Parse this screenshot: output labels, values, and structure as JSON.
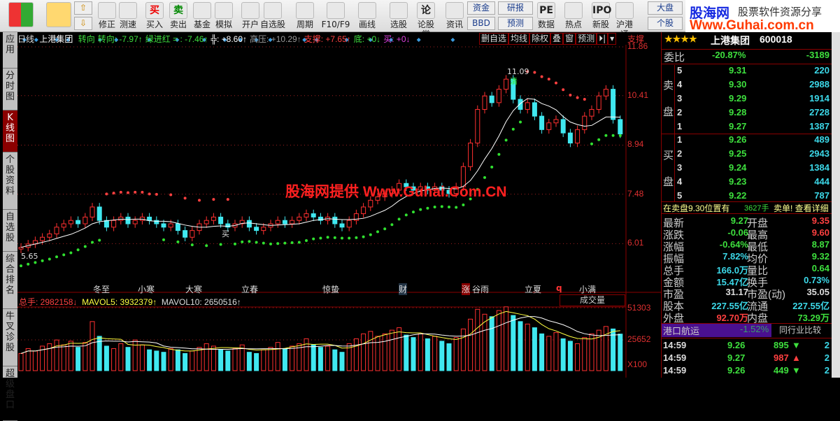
{
  "toolbar": {
    "buttons": [
      {
        "label": "",
        "icon": "windows-grid-icon"
      },
      {
        "label": "",
        "icon": "back-arrow-icon"
      },
      {
        "label": "修正",
        "icon": "refresh-icon"
      },
      {
        "label": "测速",
        "icon": "clock-icon"
      },
      {
        "label": "买入",
        "icon": "buy-icon",
        "glyph": "买"
      },
      {
        "label": "卖出",
        "icon": "sell-icon",
        "glyph": "卖"
      },
      {
        "label": "基金",
        "icon": "fund-icon"
      },
      {
        "label": "模拟",
        "icon": "gavel-icon"
      },
      {
        "label": "开户",
        "icon": "lock-icon"
      },
      {
        "label": "自选股",
        "icon": "folder-star-icon"
      },
      {
        "label": "周期",
        "icon": "period-icon"
      },
      {
        "label": "F10/F9",
        "icon": "f10-icon"
      },
      {
        "label": "画线",
        "icon": "pencil-icon"
      },
      {
        "label": "选股",
        "icon": "select-stock-icon"
      },
      {
        "label": "论股堂",
        "icon": "forum-icon",
        "glyph": "论"
      },
      {
        "label": "资讯",
        "icon": "news-icon"
      },
      {
        "label": "数据",
        "icon": "pe-icon",
        "glyph": "PE"
      },
      {
        "label": "热点",
        "icon": "hot-icon"
      },
      {
        "label": "新股",
        "icon": "ipo-icon",
        "glyph": "IPO"
      },
      {
        "label": "沪港通",
        "icon": "sse-hke-icon"
      }
    ],
    "small": {
      "zijin": "资金",
      "bbd": "BBD",
      "yanbao": "研报",
      "yuce": "预测",
      "dapan": "大盘",
      "gegu": "个股"
    }
  },
  "logo": {
    "brand": "股海网",
    "slogan": "股票软件资源分享",
    "url": "Www.Guhai.com.cn"
  },
  "sidebar": [
    "应用",
    "分时图",
    "K线图",
    "个股资料",
    "自选股",
    "综合排名",
    "牛叉诊股",
    "超级盘口"
  ],
  "chart": {
    "period": "日线",
    "stock": "上港集团",
    "indicators": [
      {
        "t": "转向",
        "c": "#3ee03e"
      },
      {
        "t": "转向: -7.97↑",
        "c": "#3ee03e"
      },
      {
        "t": "绿进红 = : -7.46↑",
        "c": "#3ee03e"
      },
      {
        "t": "╬: +8.60↑",
        "c": "#ffffff"
      },
      {
        "t": "高压: +10.29↑",
        "c": "#999999"
      },
      {
        "t": "支撑: +7.65↑",
        "c": "#ff4040"
      },
      {
        "t": "底: +0↓",
        "c": "#3ee03e"
      },
      {
        "t": "买: +0↓",
        "c": "#e040e0"
      }
    ],
    "buttons": [
      "删自选",
      "均线",
      "除权",
      "叠",
      "窗",
      "预测",
      "⏵|",
      "▾"
    ],
    "axis_top": "支撑",
    "price_ticks": [
      "11.86",
      "10.41",
      "8.94",
      "7.48",
      "6.01"
    ],
    "vol_ticks": [
      "51303",
      "25652",
      "X100"
    ],
    "annotations": {
      "high": "11.09",
      "qing": "清",
      "low": "5.65",
      "buy": "买"
    },
    "watermark": "股海网提供 Www.Guhai.Com.CN",
    "terms": [
      "冬至",
      "小寒",
      "大寒",
      "立春",
      "惊蛰",
      "财",
      "涨",
      "谷雨",
      "立夏",
      "q",
      "小满"
    ],
    "volume": {
      "total": "总手: 2982158↓",
      "ma5": "MAVOL5: 3932379↑",
      "ma10": "MAVOL10: 2650516↑",
      "label": "成交量"
    },
    "colors": {
      "up": "#ff3030",
      "down": "#40e8f0",
      "ma": "#ffffff"
    },
    "closes": [
      5.9,
      6.0,
      6.1,
      6.2,
      6.3,
      6.5,
      6.6,
      6.7,
      6.6,
      6.8,
      7.1,
      6.7,
      6.5,
      6.7,
      6.8,
      6.6,
      6.7,
      6.8,
      6.7,
      6.6,
      6.5,
      6.6,
      6.4,
      6.2,
      6.4,
      6.6,
      6.7,
      6.8,
      6.6,
      6.5,
      6.6,
      6.7,
      6.5,
      6.4,
      6.5,
      6.6,
      6.7,
      6.6,
      6.7,
      6.8,
      6.9,
      6.8,
      6.7,
      6.8,
      6.6,
      6.5,
      6.7,
      6.9,
      7.1,
      7.3,
      7.4,
      7.5,
      7.6,
      7.8,
      7.7,
      7.6,
      7.7,
      7.6,
      7.7,
      7.6,
      7.5,
      7.7,
      8.3,
      9.0,
      10.0,
      10.4,
      10.2,
      10.6,
      10.9,
      10.3,
      10.0,
      10.2,
      9.8,
      9.4,
      9.6,
      9.7,
      9.3,
      9.0,
      9.4,
      9.8,
      10.0,
      10.4,
      10.6,
      9.7,
      9.27
    ],
    "volumes": [
      14000,
      18000,
      16000,
      20000,
      22000,
      25000,
      21000,
      24000,
      19000,
      23000,
      40000,
      28000,
      20000,
      18000,
      22000,
      19000,
      25000,
      21000,
      17000,
      16000,
      15000,
      18000,
      17000,
      14000,
      16000,
      19000,
      22000,
      20000,
      17000,
      16000,
      18000,
      21000,
      15000,
      14000,
      17000,
      19000,
      23000,
      18000,
      20000,
      22000,
      26000,
      21000,
      19000,
      20000,
      17000,
      15000,
      22000,
      26000,
      30000,
      32000,
      28000,
      30000,
      33000,
      35000,
      29000,
      27000,
      30000,
      26000,
      28000,
      24000,
      22000,
      27000,
      34000,
      42000,
      50000,
      46000,
      44000,
      49000,
      52000,
      45000,
      40000,
      38000,
      35000,
      30000,
      28000,
      31000,
      26000,
      24000,
      22000,
      27000,
      30000,
      33000,
      36000,
      34000,
      29820
    ]
  },
  "quote": {
    "title": "上港集团",
    "code": "600018",
    "weibi_label": "委比",
    "weibi": "-20.87%",
    "weicha": "-3189",
    "sell_label": [
      "卖",
      "盘"
    ],
    "buy_label": [
      "买",
      "盘"
    ],
    "sells": [
      [
        "5",
        "9.31",
        "220"
      ],
      [
        "4",
        "9.30",
        "2988"
      ],
      [
        "3",
        "9.29",
        "1914"
      ],
      [
        "2",
        "9.28",
        "2728"
      ],
      [
        "1",
        "9.27",
        "1387"
      ]
    ],
    "buys": [
      [
        "1",
        "9.26",
        "489"
      ],
      [
        "2",
        "9.25",
        "2943"
      ],
      [
        "3",
        "9.24",
        "1384"
      ],
      [
        "4",
        "9.23",
        "444"
      ],
      [
        "5",
        "9.22",
        "787"
      ]
    ],
    "notice": {
      "text": "在卖盘9.30位置有",
      "qty": "3627手",
      "tail": "卖单! 查看详细"
    },
    "stats": [
      [
        "最新",
        "9.27",
        "g",
        "开盘",
        "9.35",
        "red"
      ],
      [
        "涨跌",
        "-0.06",
        "g",
        "最高",
        "9.60",
        "red"
      ],
      [
        "涨幅",
        "-0.64%",
        "g",
        "最低",
        "8.87",
        "g"
      ],
      [
        "振幅",
        "7.82%",
        "c",
        "均价",
        "9.32",
        "g"
      ],
      [
        "总手",
        "166.0万",
        "c",
        "量比",
        "0.64",
        "g"
      ],
      [
        "金额",
        "15.47亿",
        "c",
        "换手",
        "0.73%",
        "c"
      ],
      [
        "市盈",
        "31.17",
        "w",
        "市盈(动)",
        "35.05",
        "w"
      ],
      [
        "股本",
        "227.55亿",
        "c",
        "流通",
        "227.55亿",
        "c"
      ],
      [
        "外盘",
        "92.70万",
        "red",
        "内盘",
        "73.29万",
        "g"
      ]
    ],
    "industry": {
      "name": "港口航运",
      "change": "-1.52%",
      "compare": "同行业比较"
    },
    "ticks": [
      [
        "14:59",
        "9.26",
        "895",
        "down",
        "2"
      ],
      [
        "14:59",
        "9.27",
        "987",
        "up",
        "2"
      ],
      [
        "14:59",
        "9.26",
        "449",
        "down",
        "2"
      ]
    ]
  }
}
